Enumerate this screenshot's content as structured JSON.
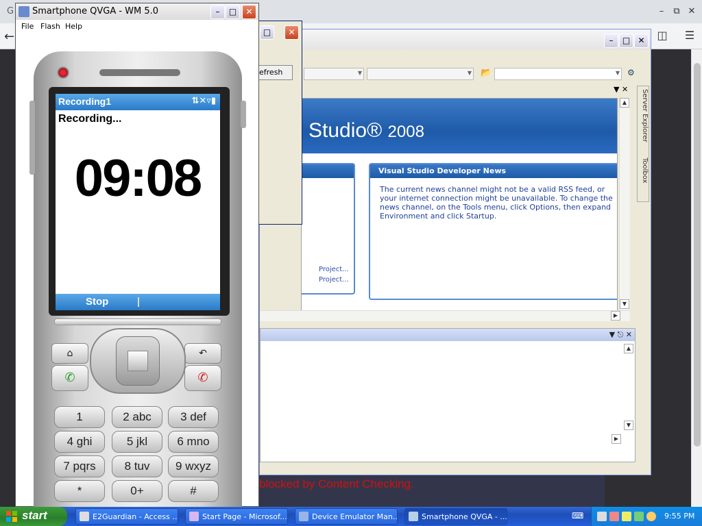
{
  "browser": {
    "tab_text": "G",
    "back_icon": "arrow-left-icon",
    "min_icon": "minimize-icon",
    "restore_icon": "restore-icon",
    "close_icon": "close-icon",
    "blocked_text": "blocked by Content Checking."
  },
  "visual_studio": {
    "banner_title": "Studio",
    "banner_year": "2008",
    "news_header": "Visual Studio Developer News",
    "news_body": "The current news channel might not be a valid RSS feed, or your internet connection might be unavailable. To change the news channel, on the Tools menu, click Options, then expand Environment and click Startup.",
    "recent_links": [
      "Project...",
      "Project..."
    ],
    "dock_tabs": [
      "Server Explorer",
      "Toolbox"
    ]
  },
  "device_emulator_manager": {
    "refresh_label": "efresh"
  },
  "emulator": {
    "title": "Smartphone QVGA - WM 5.0",
    "menus": [
      "File",
      "Flash",
      "Help"
    ],
    "screen": {
      "app_title": "Recording1",
      "status_text": "Recording...",
      "timer": "09:08",
      "softkey_left": "Stop"
    },
    "keys": {
      "home": "⌂",
      "back": "↶",
      "call": "✆",
      "end": "✆",
      "numpad": [
        "1",
        "2 abc",
        "3 def",
        "4 ghi",
        "5 jkl",
        "6 mno",
        "7 pqrs",
        "8 tuv",
        "9 wxyz",
        "*",
        "0+",
        "#"
      ]
    }
  },
  "taskbar": {
    "start_label": "start",
    "buttons": [
      {
        "label": "E2Guardian - Access ...",
        "active": false
      },
      {
        "label": "Start Page - Microsof...",
        "active": false
      },
      {
        "label": "Device Emulator Man...",
        "active": false
      },
      {
        "label": "Smartphone QVGA - ...",
        "active": true
      }
    ],
    "clock": "9:55 PM"
  }
}
